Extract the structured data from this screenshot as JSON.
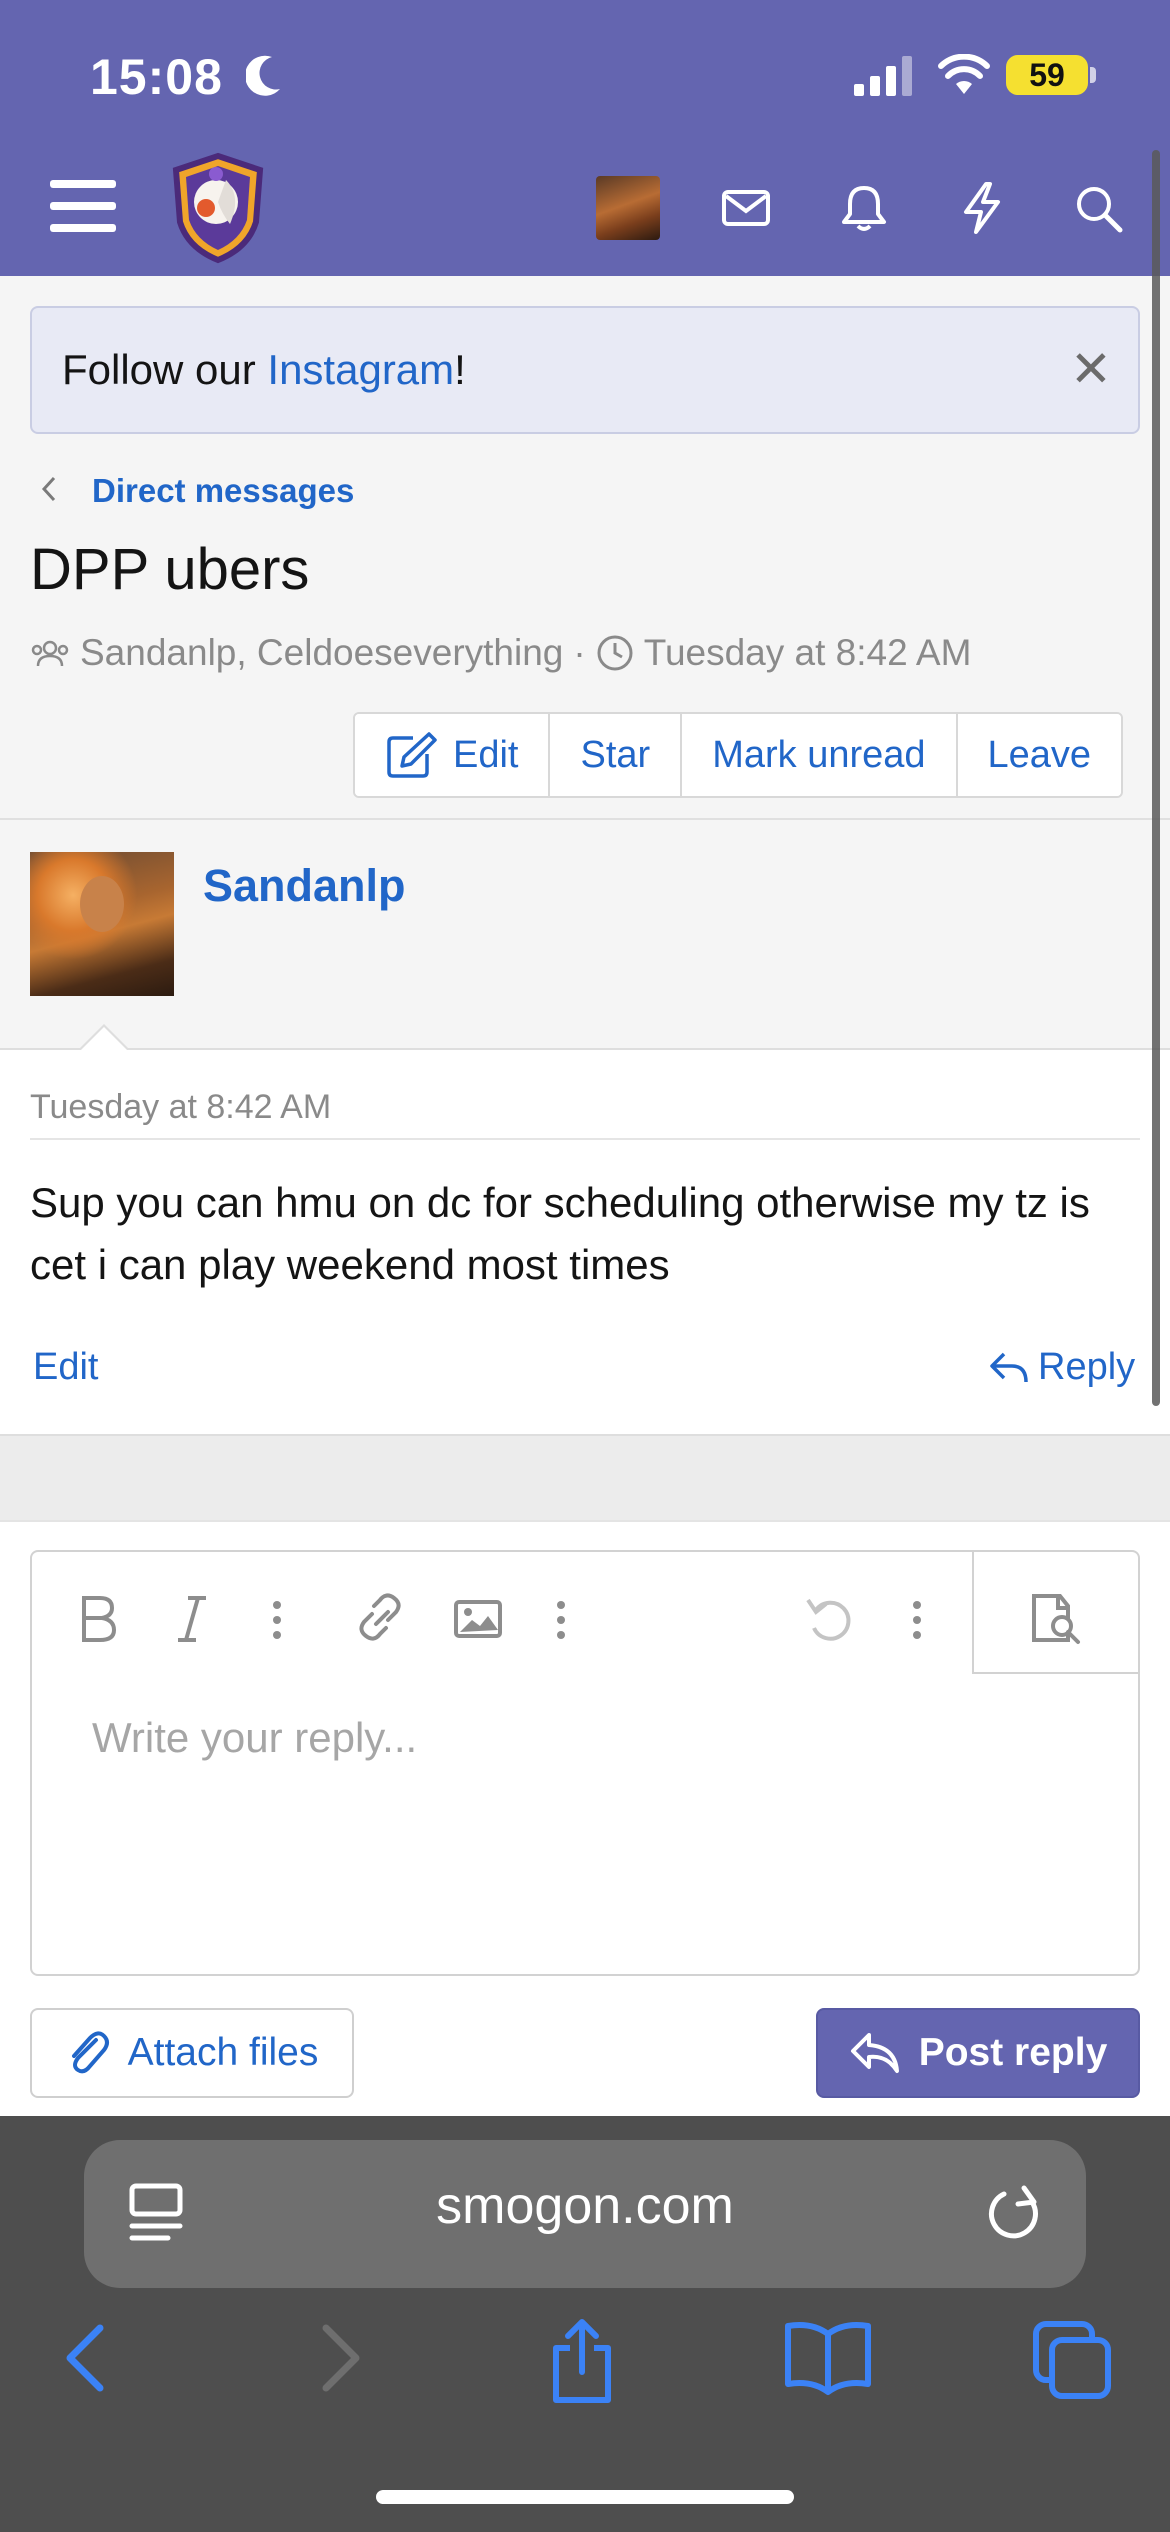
{
  "status": {
    "time": "15:08",
    "battery": "59"
  },
  "notice": {
    "prefix": "Follow our ",
    "link": "Instagram",
    "suffix": "!",
    "close": "✕"
  },
  "breadcrumb": {
    "label": "Direct messages"
  },
  "conversation": {
    "title": "DPP ubers",
    "participants": "Sandanlp, Celdoeseverything",
    "separator": "·",
    "started": "Tuesday at 8:42 AM"
  },
  "actions": {
    "edit": "Edit",
    "star": "Star",
    "mark_unread": "Mark unread",
    "leave": "Leave"
  },
  "message": {
    "author": "Sandanlp",
    "date": "Tuesday at 8:42 AM",
    "text": "Sup you can hmu on dc for scheduling otherwise my tz is cet i can play weekend most times",
    "edit": "Edit",
    "reply": "Reply"
  },
  "editor": {
    "placeholder": "Write your reply..."
  },
  "footer": {
    "attach": "Attach files",
    "post": "Post reply"
  },
  "browser": {
    "url": "smogon.com"
  },
  "colors": {
    "brand": "#6465b0",
    "link": "#2166c8",
    "battery": "#f5e030"
  },
  "icons": [
    "moon-icon",
    "signal-icon",
    "wifi-icon",
    "hamburger-icon",
    "mail-icon",
    "bell-icon",
    "bolt-icon",
    "search-icon",
    "clock-icon",
    "users-icon",
    "pencil-icon",
    "reply-icon",
    "bold-icon",
    "italic-icon",
    "link-icon",
    "image-icon",
    "undo-icon",
    "preview-icon",
    "paperclip-icon",
    "reader-icon",
    "reload-icon",
    "back-icon",
    "forward-icon",
    "share-icon",
    "bookmarks-icon",
    "tabs-icon"
  ]
}
